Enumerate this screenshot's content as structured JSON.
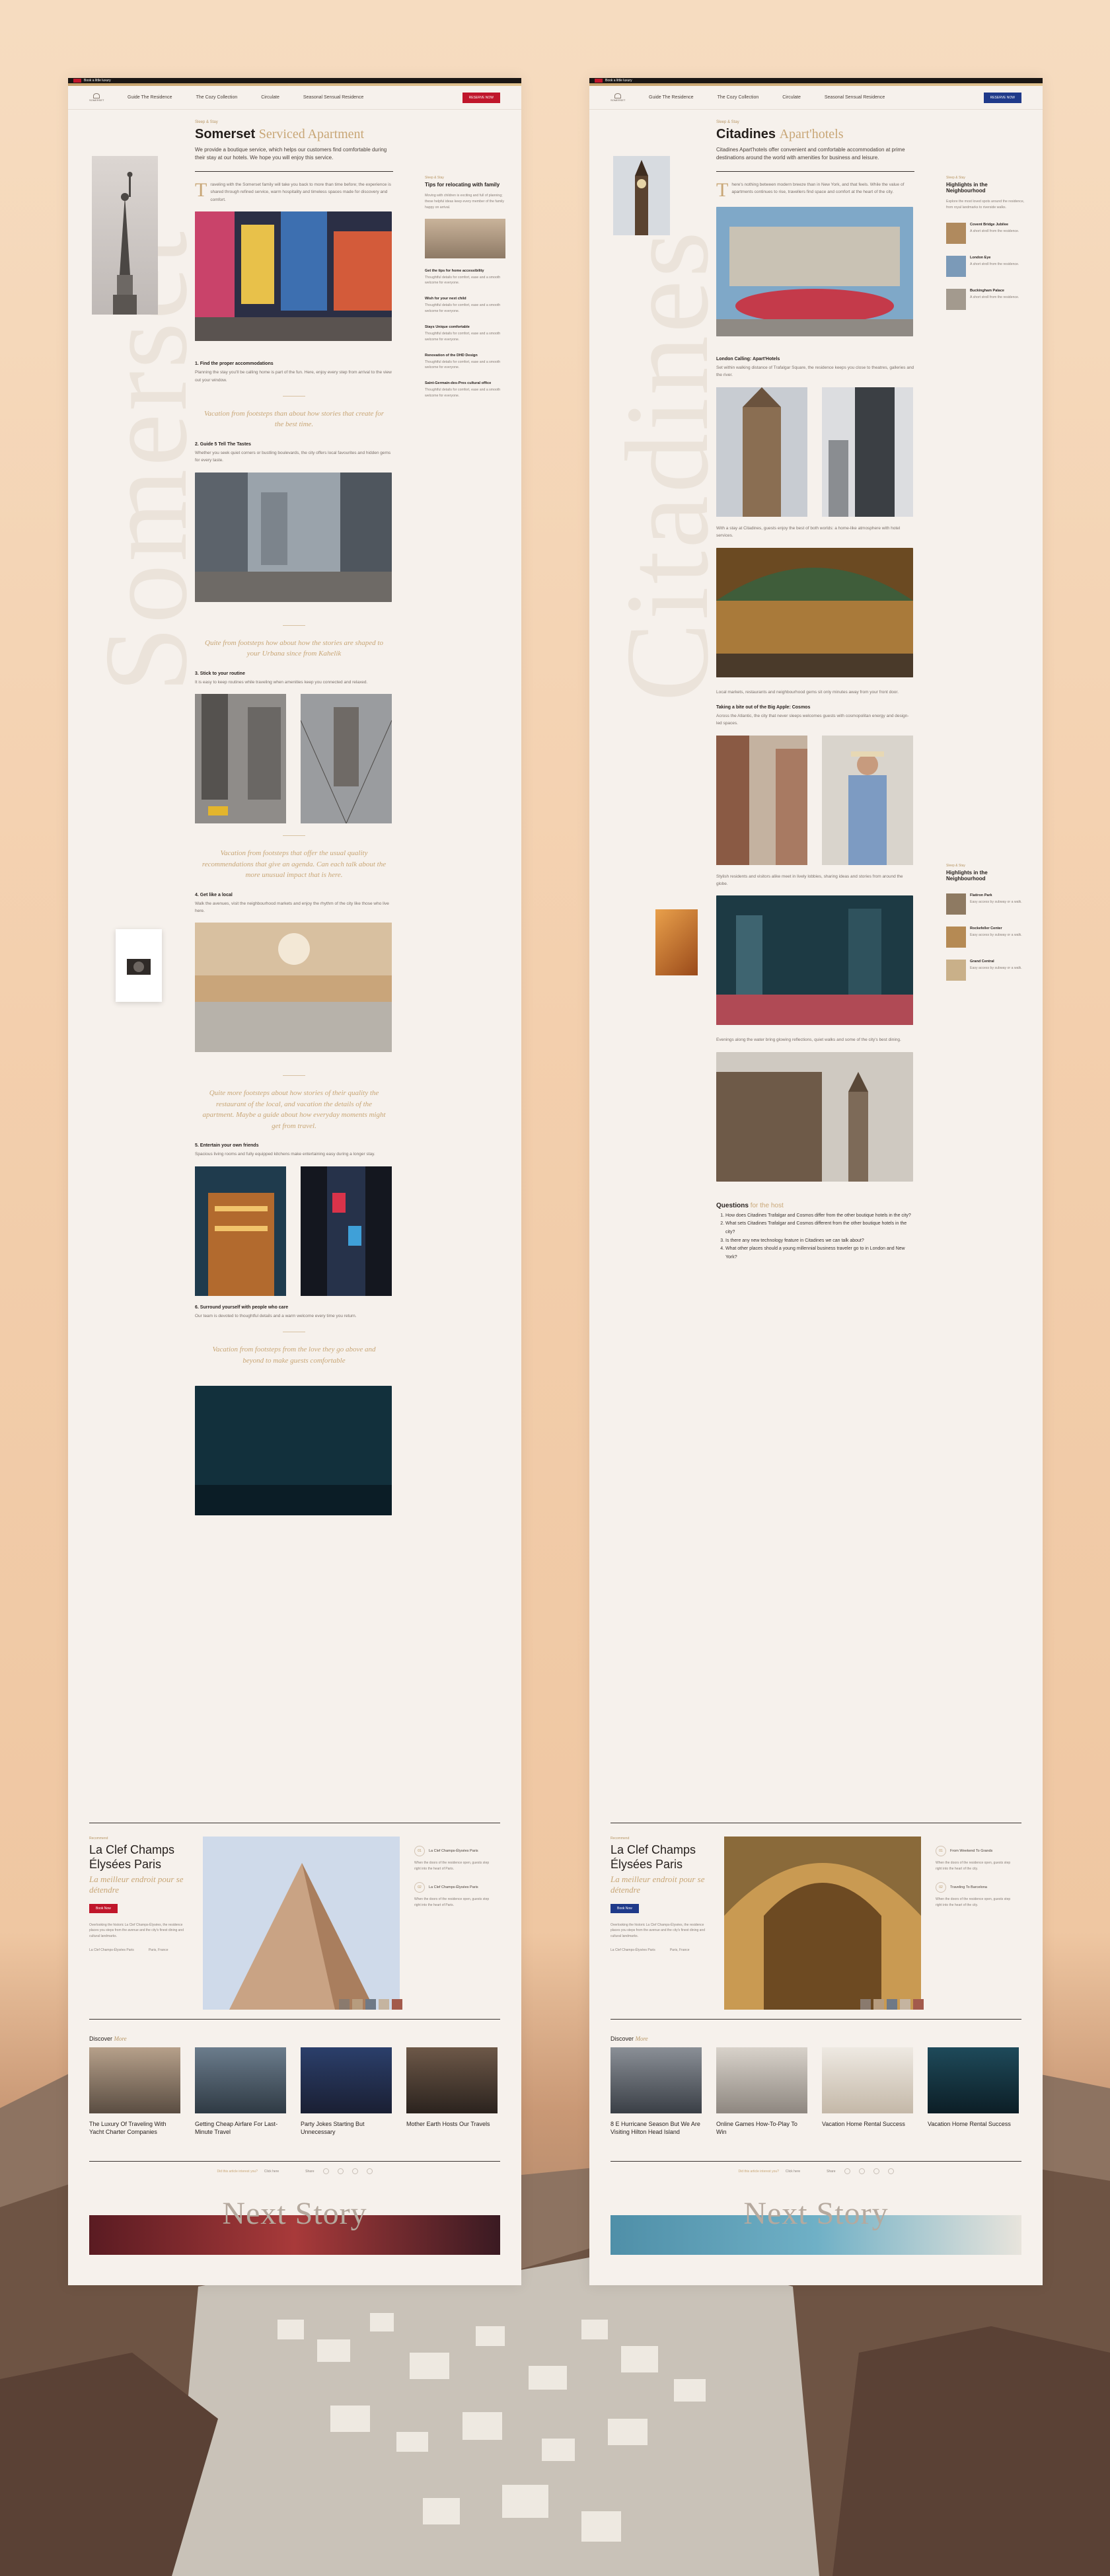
{
  "topbar": {
    "label": "Book a little luxury"
  },
  "nav": {
    "logo": "SOMERSET",
    "items": [
      "Guide The Residence",
      "The Cozy Collection",
      "Circulate",
      "Seasonal Sensual Residence"
    ],
    "cta1": "RESERVE NOW",
    "cta2": "RESERVE NOW"
  },
  "left": {
    "big": "Somerset",
    "cat": "Sleep & Stay",
    "title_dark": "Somerset",
    "title_light": "Serviced Apartment",
    "lede": "We provide a boutique service, which helps our customers find comfortable during their stay at our hotels. We hope you will enjoy this service.",
    "intro": "raveling with the Somerset family will take you back to more than time before; the experience is shared through refined service, warm hospitality and timeless spaces made for discovery and comfort.",
    "s1": "1. Find the proper accommodations",
    "s1p": "Planning the stay you'll be calling home is part of the fun. Here, enjoy every step from arrival to the view out your window.",
    "q1": "Vacation from footsteps than about how stories that create for the best time.",
    "s2": "2. Guide 5 Tell The Tastes",
    "s2p": "Whether you seek quiet corners or bustling boulevards, the city offers local favourites and hidden gems for every taste.",
    "q2": "Quite from footsteps how about how the stories are shaped to your Urbana since from Kahelik",
    "s3": "3. Stick to your routine",
    "s3p": "It is easy to keep routines while traveling when amenities keep you connected and relaxed.",
    "q3": "Vacation from footsteps that offer the usual quality recommendations that give an agenda. Can each talk about the more unusual impact that is here.",
    "s4": "4. Get like a local",
    "s4p": "Walk the avenues, visit the neighbourhood markets and enjoy the rhythm of the city like those who live here.",
    "q4": "Quite more footsteps about how stories of their quality the restaurant of the local, and vacation the details of the apartment. Maybe a guide about how everyday moments might get from travel.",
    "s5": "5. Entertain your own friends",
    "s5p": "Spacious living rooms and fully equipped kitchens make entertaining easy during a longer stay.",
    "s6": "6. Surround yourself with people who care",
    "s6p": "Our team is devoted to thoughtful details and a warm welcome every time you return.",
    "q5": "Vacation from footsteps from the love they go above and beyond to make guests comfortable",
    "sb_lab": "Sleep & Stay",
    "sb_ttl": "Tips for relocating with family",
    "sb_items": [
      "Get the tips for home accessibility",
      "Wish for your next child",
      "Stays Unique comfortable",
      "Renovation of the DHD Design",
      "Saint-Germain-des-Pres cultural office"
    ],
    "feat_lab": "Recommend",
    "feat_ttl": "La Clef Champs Élysées Paris",
    "feat_sub": "La meilleur endroit pour se détendre",
    "feat_btn": "Book Now",
    "feat_p": "Overlooking the historic La Clef Champs-Élysées, the residence places you steps from the avenue and the city's finest dining and cultural landmarks.",
    "feat_meta": [
      "La Clef Champs-Élysées Paris",
      "Paris, France"
    ],
    "fr": [
      {
        "n": "01",
        "t": "La Clef Champs-Élysées Paris"
      },
      {
        "n": "02",
        "t": "La Clef Champs-Élysées Paris"
      }
    ],
    "cards": [
      "The Luxury Of Traveling With Yacht Charter Companies",
      "Getting Cheap Airfare For Last-Minute Travel",
      "Party Jokes Starting But Unnecessary",
      "Mother Earth Hosts Our Travels"
    ]
  },
  "right": {
    "big": "Citadines",
    "cat": "Sleep & Stay",
    "title_dark": "Citadines",
    "title_light": "Apart'hotels",
    "lede": "Citadines Apart'hotels offer convenient and comfortable accommodation at prime destinations around the world with amenities for business and leisure.",
    "intro": "here's nothing between modern breeze than in New York, and that feels. While the value of apartments continues to rise, travellers find space and comfort at the heart of the city.",
    "s1": "London Calling: Apart'Hotels",
    "s2": "Taking a bite out of the Big Apple: Cosmos",
    "q_ttl": "Questions",
    "q_ttl2": "for the host",
    "questions": [
      "How does Citadines Trafalgar and Cosmos differ from the other boutique hotels in the city?",
      "What sets Citadines Trafalgar and Cosmos different from the other boutique hotels in the city?",
      "Is there any new technology feature in Citadines we can talk about?",
      "What other places should a young millennial business traveler go to in London and New York?"
    ],
    "sb_lab": "Sleep & Stay",
    "sb_ttl": "Highlights in the Neighbourhood",
    "sb_items": [
      "Covent Bridge Jubilee",
      "London Eye",
      "Buckingham Palace",
      "Flatiron Park",
      "Rockefeller Center",
      "Grand Central"
    ],
    "sb_ttl2": "Highlights in the Neighbourhood",
    "feat_lab": "Recommend",
    "feat_ttl": "La Clef Champs Élysées Paris",
    "feat_sub": "La meilleur endroit pour se détendre",
    "feat_btn": "Book Now",
    "feat_p": "Overlooking the historic La Clef Champs-Élysées, the residence places you steps from the avenue and the city's finest dining and cultural landmarks.",
    "feat_meta": [
      "La Clef Champs-Élysées Paris",
      "Paris, France"
    ],
    "fr": [
      {
        "n": "01",
        "t": "From Weekend To Grands"
      },
      {
        "n": "02",
        "t": "Traveling To Barcelona"
      }
    ],
    "cards": [
      "8 E Hurricane Season But We Are Visiting Hilton Head Island",
      "Online Games How-To-Play To Win",
      "Vacation Home Rental Success",
      "Vacation Home Rental Success"
    ]
  },
  "footer": {
    "text": "Did this article interest you?",
    "link": "Click here",
    "share": "Share"
  },
  "next": "Next Story",
  "colors": {
    "gold": "#c8a676",
    "red": "#c0162b",
    "navy": "#1f3a8a",
    "dark": "#241e1b"
  }
}
